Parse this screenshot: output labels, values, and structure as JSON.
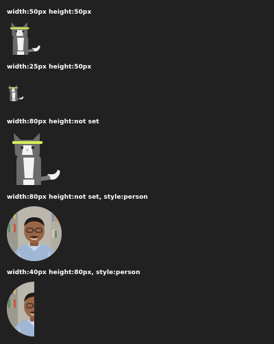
{
  "examples": [
    {
      "label": "width:50px height:50px",
      "image": "cat-icon"
    },
    {
      "label": "width:25px height:50px",
      "image": "cat-icon"
    },
    {
      "label": "width:80px height:not set",
      "image": "cat-icon"
    },
    {
      "label": "width:80px height:not set, style:person",
      "image": "person-avatar"
    },
    {
      "label": "width:40px height:80px, style:person",
      "image": "person-avatar"
    }
  ],
  "colors": {
    "background": "#212121",
    "text": "#ffffff",
    "cat_gray": "#6b6b6b",
    "cat_white": "#f2f2f2",
    "headband": "#d8ec5a"
  }
}
